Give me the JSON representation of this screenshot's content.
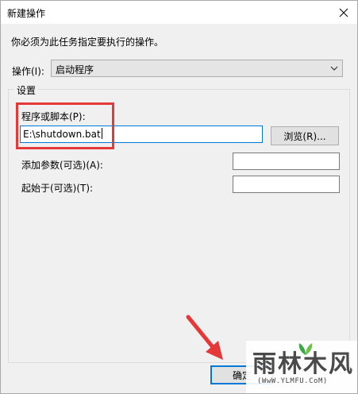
{
  "window": {
    "title": "新建操作",
    "instruction": "你必须为此任务指定要执行的操作。"
  },
  "action": {
    "label": "操作(I):",
    "selected": "启动程序"
  },
  "settings": {
    "legend": "设置",
    "program_label": "程序或脚本(P):",
    "program_value": "E:\\shutdown.bat",
    "browse_label": "浏览(R)...",
    "args_label": "添加参数(可选)(A):",
    "args_value": "",
    "start_label": "起始于(可选)(T):",
    "start_value": ""
  },
  "footer": {
    "ok_label": "确定"
  },
  "watermark": {
    "text": "雨林木风",
    "sub": "(WwW.YLMFU.CoM)"
  },
  "colors": {
    "highlight": "#e53838",
    "focus": "#0078d7"
  }
}
